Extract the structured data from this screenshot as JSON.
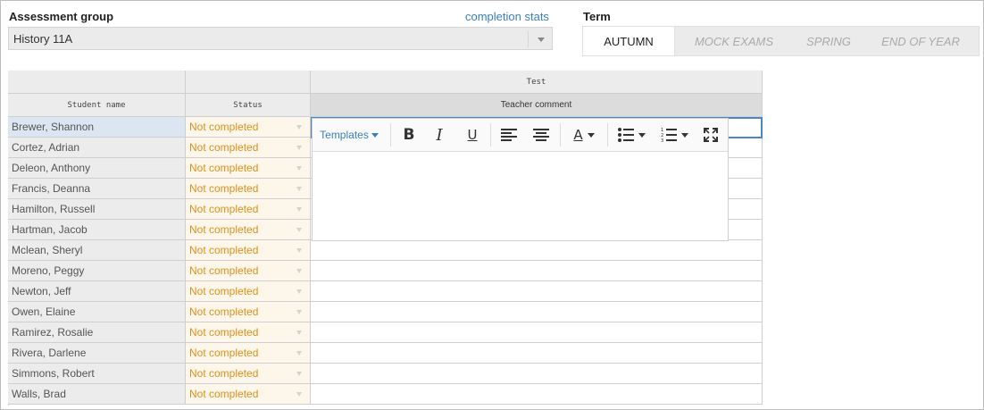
{
  "header": {
    "assessment_group_label": "Assessment group",
    "completion_stats_link": "completion stats",
    "assessment_group_value": "History 11A",
    "term_label": "Term"
  },
  "term_tabs": [
    {
      "label": "AUTUMN",
      "active": true
    },
    {
      "label": "MOCK EXAMS",
      "active": false
    },
    {
      "label": "SPRING",
      "active": false
    },
    {
      "label": "END OF YEAR",
      "active": false
    }
  ],
  "grid": {
    "group_header": "Test",
    "columns": {
      "student_name": "Student name",
      "status": "Status",
      "teacher_comment": "Teacher comment"
    },
    "rows": [
      {
        "name": "Brewer, Shannon",
        "status": "Not completed"
      },
      {
        "name": "Cortez, Adrian",
        "status": "Not completed"
      },
      {
        "name": "Deleon, Anthony",
        "status": "Not completed"
      },
      {
        "name": "Francis, Deanna",
        "status": "Not completed"
      },
      {
        "name": "Hamilton, Russell",
        "status": "Not completed"
      },
      {
        "name": "Hartman, Jacob",
        "status": "Not completed"
      },
      {
        "name": "Mclean, Sheryl",
        "status": "Not completed"
      },
      {
        "name": "Moreno, Peggy",
        "status": "Not completed"
      },
      {
        "name": "Newton, Jeff",
        "status": "Not completed"
      },
      {
        "name": "Owen, Elaine",
        "status": "Not completed"
      },
      {
        "name": "Ramirez, Rosalie",
        "status": "Not completed"
      },
      {
        "name": "Rivera, Darlene",
        "status": "Not completed"
      },
      {
        "name": "Simmons, Robert",
        "status": "Not completed"
      },
      {
        "name": "Walls, Brad",
        "status": "Not completed"
      }
    ]
  },
  "editor": {
    "templates_label": "Templates",
    "font_color_glyph": "A",
    "toolbar_icons": [
      "bold-icon",
      "italic-icon",
      "underline-icon",
      "align-left-icon",
      "align-center-icon",
      "font-color-icon",
      "bullet-list-icon",
      "numbered-list-icon",
      "fullscreen-icon"
    ]
  },
  "colors": {
    "link": "#3a7fc1",
    "status_text": "#e1901a",
    "status_bg": "#fdf6ea",
    "selected_row": "#dce6f3",
    "active_border": "#4a86c8"
  }
}
